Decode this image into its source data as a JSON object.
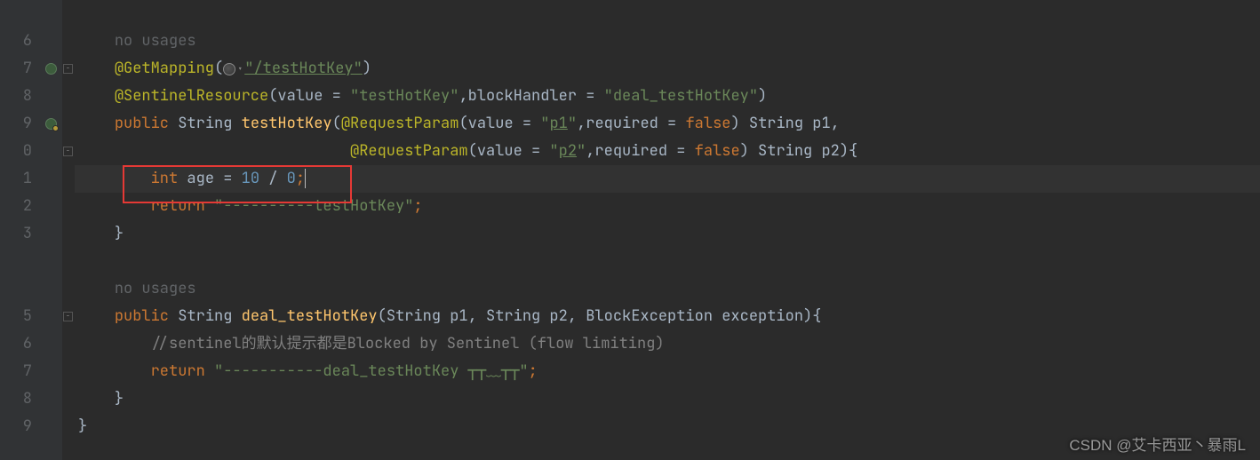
{
  "gutter": [
    "6",
    "7",
    "8",
    "9",
    "0",
    "1",
    "2",
    "3",
    "",
    "",
    "5",
    "6",
    "7",
    "8",
    "9"
  ],
  "hints": {
    "no_usages": "no usages"
  },
  "line7": {
    "anno": "@GetMapping",
    "url": "\"/testHotKey\""
  },
  "line8": {
    "anno": "@SentinelResource",
    "value_kw": "value = ",
    "value_str": "\"testHotKey\"",
    "sep": ",blockHandler = ",
    "bh_str": "\"deal_testHotKey\""
  },
  "line9": {
    "public": "public ",
    "ret": "String ",
    "name": "testHotKey",
    "rp": "@RequestParam",
    "v_kw": "value = ",
    "v_str": "\"",
    "p1": "p1",
    "v_end": "\"",
    "req_kw": ",required = ",
    "false": "false",
    "tail": ") String p1,"
  },
  "line10": {
    "rp": "@RequestParam",
    "v_kw": "value = ",
    "v_str": "\"",
    "p2": "p2",
    "v_end": "\"",
    "req_kw": ",required = ",
    "false": "false",
    "tail": ") String p2){"
  },
  "line11": {
    "int": "int ",
    "age": "age",
    "eq": " = ",
    "n10": "10",
    "div": " / ",
    "n0": "0",
    "semi": ";"
  },
  "line12": {
    "return": "return ",
    "str": "\"----------testHotKey\"",
    "semi": ";"
  },
  "line13": {
    "brace": "}"
  },
  "line15": {
    "public": "public ",
    "ret": "String ",
    "name": "deal_testHotKey",
    "params": "(String p1, String p2, BlockException exception){"
  },
  "line16": {
    "comment": "//sentinel的默认提示都是Blocked by Sentinel (flow limiting)"
  },
  "line17": {
    "return": "return ",
    "str": "\"-----------deal_testHotKey ┬┬﹏┬┬\"",
    "semi": ";"
  },
  "line18": {
    "brace": "}"
  },
  "line19": {
    "brace": "}"
  },
  "indent": {
    "i1": "    ",
    "i2": "        ",
    "i10": "                              ",
    "class_close": "  "
  },
  "watermark": "CSDN @艾卡西亚丶暴雨L"
}
